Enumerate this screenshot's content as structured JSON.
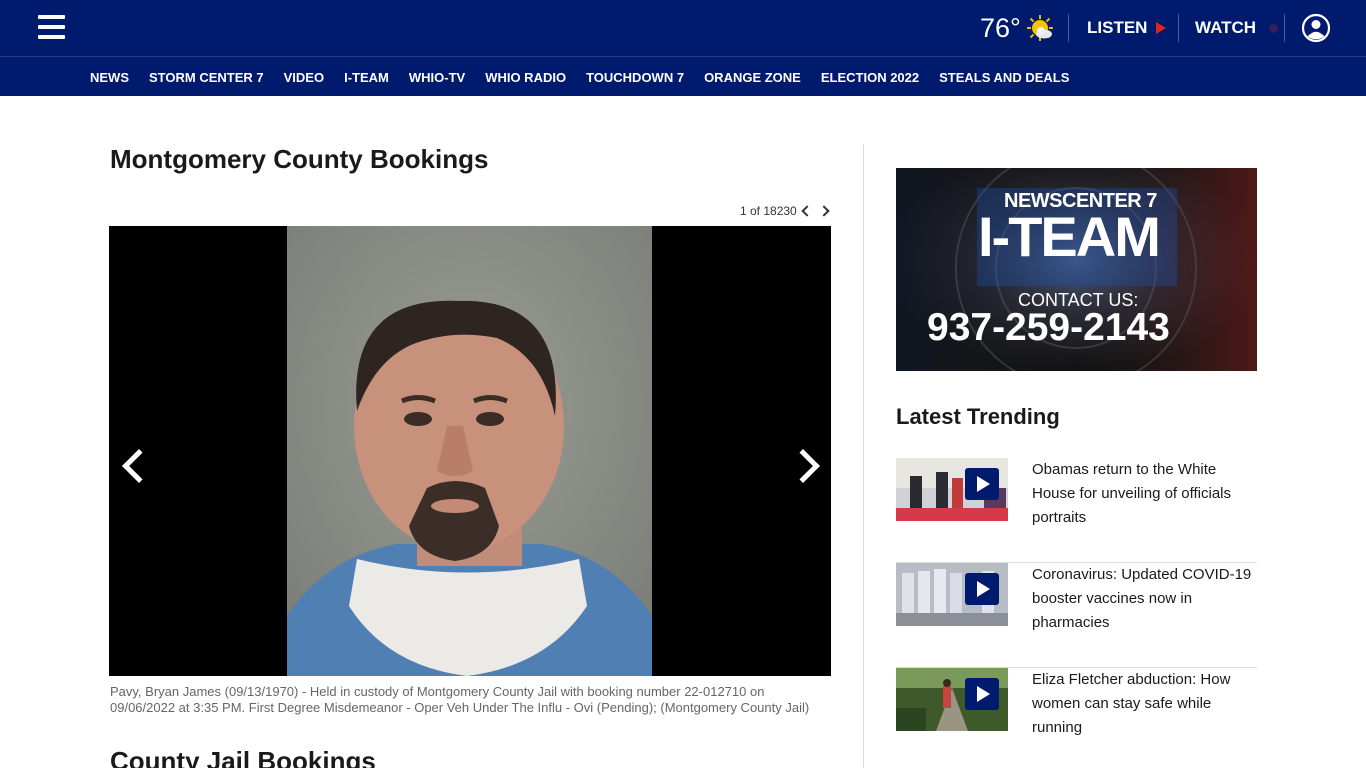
{
  "header": {
    "temperature": "76°",
    "weather_icon": "sun-cloud-icon",
    "listen_label": "LISTEN",
    "watch_label": "WATCH",
    "brand_color": "#001a6e",
    "accent_red": "#e2241b"
  },
  "nav": {
    "items": [
      "NEWS",
      "STORM CENTER 7",
      "VIDEO",
      "I-TEAM",
      "WHIO-TV",
      "WHIO RADIO",
      "TOUCHDOWN 7",
      "ORANGE ZONE",
      "ELECTION 2022",
      "STEALS AND DEALS"
    ]
  },
  "main": {
    "title": "Montgomery County Bookings",
    "counter": "1 of 18230",
    "caption": "Pavy, Bryan James (09/13/1970) - Held in custody of Montgomery County Jail with booking number 22-012710 on 09/06/2022 at 3:35 PM. First Degree Misdemeanor - Oper Veh Under The Influ - Ovi (Pending); (Montgomery County Jail)",
    "next_section_title": "County Jail Bookings"
  },
  "sidebar": {
    "ad": {
      "brand": "NEWSCENTER 7",
      "title": "I-TEAM",
      "contact_label": "CONTACT US:",
      "phone": "937-259-2143"
    },
    "trending_title": "Latest Trending",
    "trending": [
      {
        "title": "Obamas return to the White House for unveiling of officials portraits"
      },
      {
        "title": "Coronavirus: Updated COVID-19 booster vaccines now in pharmacies"
      },
      {
        "title": "Eliza Fletcher abduction: How women can stay safe while running"
      }
    ]
  }
}
